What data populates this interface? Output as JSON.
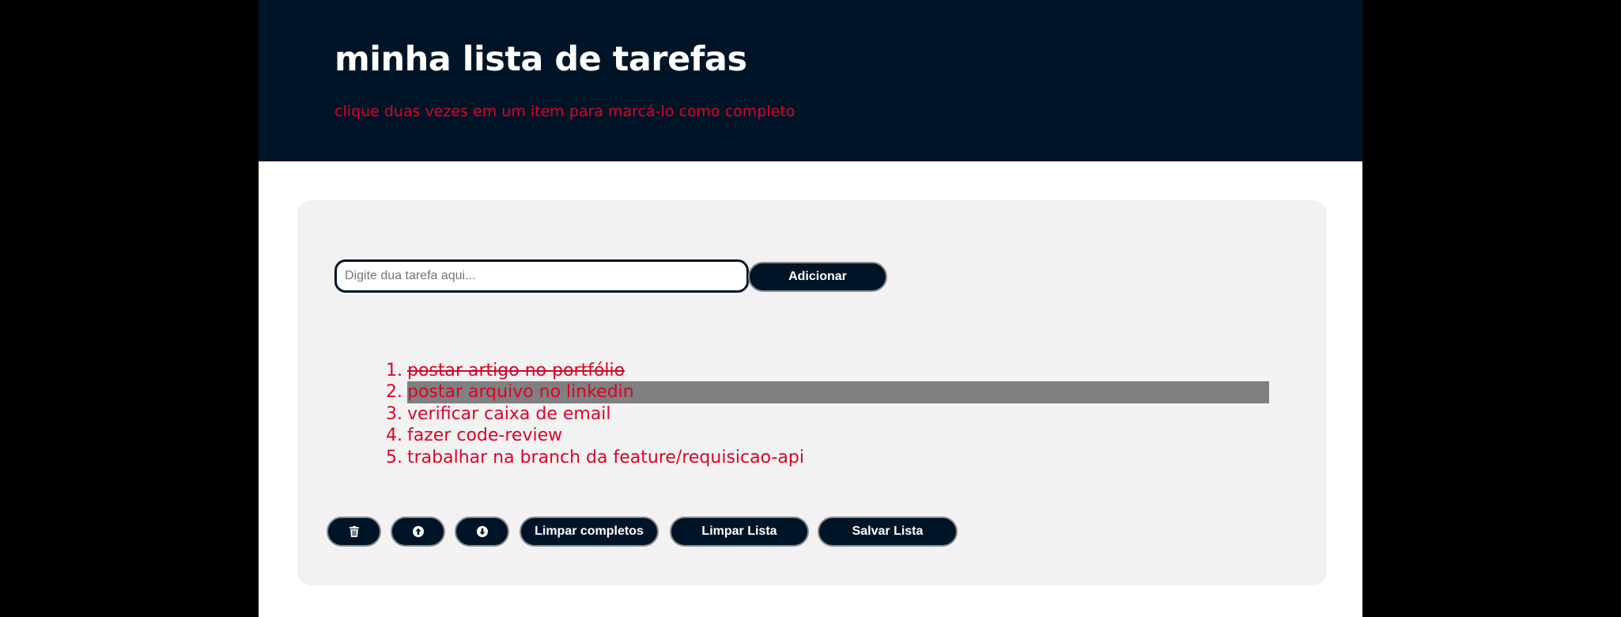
{
  "header": {
    "title": "minha lista de tarefas",
    "subtitle": "clique duas vezes em um item para marcá-lo como completo"
  },
  "form": {
    "input_value": "",
    "input_placeholder": "Digite dua tarefa aqui...",
    "add_label": "Adicionar"
  },
  "tasks": [
    {
      "number": "1.",
      "text": "postar artigo no portfólio",
      "completed": true,
      "selected": false
    },
    {
      "number": "2.",
      "text": "postar arquivo no linkedin",
      "completed": false,
      "selected": true
    },
    {
      "number": "3.",
      "text": "verificar caixa de email",
      "completed": false,
      "selected": false
    },
    {
      "number": "4.",
      "text": "fazer code-review",
      "completed": false,
      "selected": false
    },
    {
      "number": "5.",
      "text": "trabalhar na branch da feature/requisicao-api",
      "completed": false,
      "selected": false
    }
  ],
  "controls": {
    "delete_icon": "trash-icon",
    "up_icon": "arrow-circle-up-icon",
    "down_icon": "arrow-circle-down-icon",
    "clear_completed_label": "Limpar completos",
    "clear_list_label": "Limpar Lista",
    "save_list_label": "Salvar Lista"
  },
  "colors": {
    "header_bg": "#001427",
    "accent": "#d90429",
    "card_bg": "#f2f2f2",
    "selected_bg": "#808080",
    "button_bg": "#001427"
  }
}
